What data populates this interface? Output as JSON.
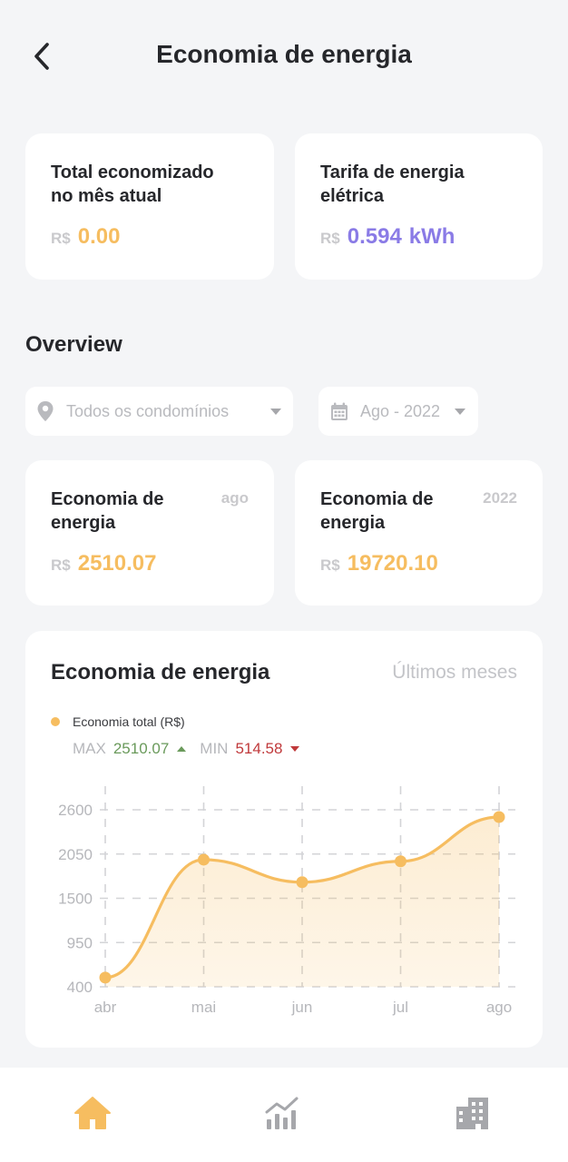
{
  "header": {
    "title": "Economia de energia",
    "back_icon": "chevron-left-icon"
  },
  "summary_cards": {
    "total": {
      "title_line1": "Total economizado",
      "title_line2": "no mês atual",
      "currency": "R$",
      "value": "0.00"
    },
    "tariff": {
      "title_line1": "Tarifa de energia",
      "title_line2": "elétrica",
      "currency": "R$",
      "value": "0.594",
      "unit": "kWh"
    }
  },
  "overview": {
    "title": "Overview",
    "condo_select": {
      "icon": "location-pin-icon",
      "value": "Todos os condomínios"
    },
    "date_select": {
      "icon": "calendar-icon",
      "value": "Ago - 2022"
    },
    "month_card": {
      "title_line1": "Economia de",
      "title_line2": "energia",
      "tag": "ago",
      "currency": "R$",
      "value": "2510.07"
    },
    "year_card": {
      "title_line1": "Economia de",
      "title_line2": "energia",
      "tag": "2022",
      "currency": "R$",
      "value": "19720.10"
    }
  },
  "chart": {
    "title": "Economia de energia",
    "period": "Últimos meses",
    "legend": "Economia total (R$)",
    "max_label": "MAX",
    "max_value": "2510.07",
    "min_label": "MIN",
    "min_value": "514.58"
  },
  "chart_data": {
    "type": "area",
    "categories": [
      "abr",
      "mai",
      "jun",
      "jul",
      "ago"
    ],
    "series": [
      {
        "name": "Economia total (R$)",
        "values": [
          514.58,
          1980,
          1700,
          1960,
          2510.07
        ]
      }
    ],
    "yticks": [
      400,
      950,
      1500,
      2050,
      2600
    ],
    "ylim": [
      400,
      2600
    ],
    "grid": true,
    "legend_position": "top-left",
    "color": "#f6bd60"
  },
  "nav": {
    "items": [
      {
        "icon": "home-icon",
        "active": true
      },
      {
        "icon": "chart-icon",
        "active": false
      },
      {
        "icon": "building-icon",
        "active": false
      }
    ]
  },
  "colors": {
    "accent": "#f6bd60",
    "purple": "#8a7be6",
    "max_green": "#6a9a5b",
    "min_red": "#c0393b",
    "background": "#f4f5f7"
  }
}
